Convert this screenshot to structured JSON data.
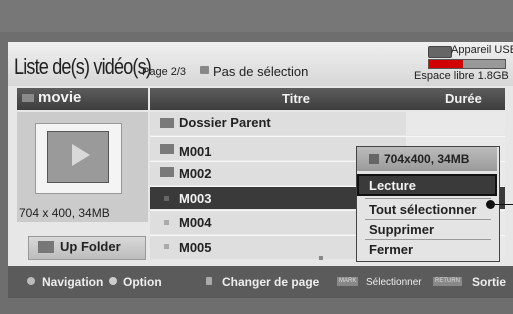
{
  "header": {
    "title": "Liste de(s) vidéo(s)",
    "page_number": "Page 2/3",
    "selection_status": "Pas de sélection",
    "device_label": "Appareil USB",
    "free_space_label": "Espace libre 1.8GB",
    "usb_fill_fraction": 0.45,
    "usb_fill_color": "#d00000"
  },
  "left_panel": {
    "folder_name": "movie",
    "preview_info": "704 x 400, 34MB",
    "up_folder_label": "Up Folder"
  },
  "table": {
    "columns": [
      "Titre",
      "Durée"
    ],
    "rows": [
      {
        "label": "Dossier Parent",
        "icon": "folder-up-icon"
      },
      {
        "label": "M001",
        "icon": "video-file-icon"
      },
      {
        "label": "M002",
        "icon": "video-file-icon"
      },
      {
        "label": "M003",
        "icon": "video-file-icon",
        "selected": true
      },
      {
        "label": "M004",
        "icon": "video-file-icon"
      },
      {
        "label": "M005",
        "icon": "video-file-icon"
      }
    ]
  },
  "popup": {
    "info": "704x400, 34MB",
    "items": [
      "Lecture",
      "Tout sélectionner",
      "Supprimer",
      "Fermer"
    ],
    "highlighted_index": 0
  },
  "footer": {
    "navigation": "Navigation",
    "option": "Option",
    "change_page": "Changer de page",
    "mark_key": "MARK",
    "select": "Sélectionner",
    "return_key": "RETURN",
    "exit": "Sortie"
  }
}
